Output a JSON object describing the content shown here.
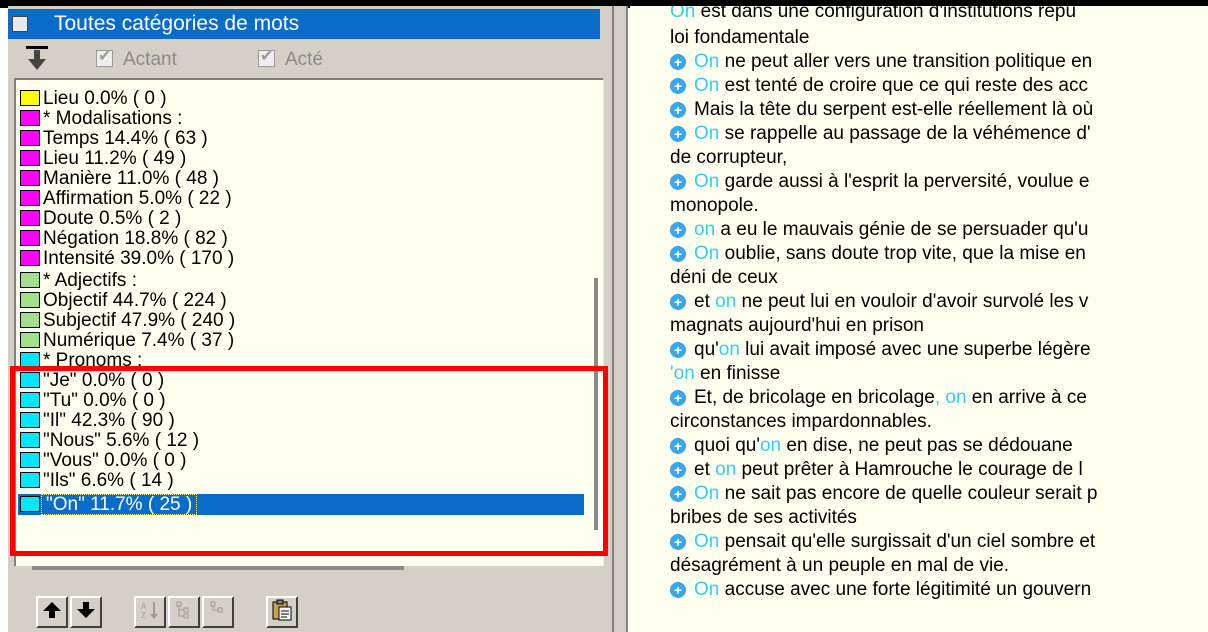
{
  "category_selector": {
    "label": "Toutes catégories de mots"
  },
  "filters": {
    "actant": {
      "label": "Actant",
      "checked": true,
      "enabled": false
    },
    "acte": {
      "label": "Acté",
      "checked": true,
      "enabled": false
    }
  },
  "colors": {
    "yellow": "#ffff00",
    "magenta": "#ff00ff",
    "green": "#a4e08c",
    "cyan": "#00e6ff",
    "selection": "#0a6cc9",
    "highlight": "#ff0000",
    "pronoun_text": "#34d0e8"
  },
  "categories": [
    {
      "label": "Lieu  0.0% ( 0 )",
      "color": "yellow"
    },
    {
      "label": "* Modalisations :",
      "color": "magenta"
    },
    {
      "label": "Temps  14.4% ( 63 )",
      "color": "magenta"
    },
    {
      "label": "Lieu  11.2% ( 49 )",
      "color": "magenta"
    },
    {
      "label": "Manière  11.0% ( 48 )",
      "color": "magenta"
    },
    {
      "label": "Affirmation  5.0% ( 22 )",
      "color": "magenta"
    },
    {
      "label": "Doute  0.5% ( 2 )",
      "color": "magenta"
    },
    {
      "label": "Négation  18.8% ( 82 )",
      "color": "magenta"
    },
    {
      "label": "Intensité  39.0% ( 170 )",
      "color": "magenta"
    },
    {
      "label": "* Adjectifs :",
      "color": "green"
    },
    {
      "label": "Objectif  44.7% ( 224 )",
      "color": "green"
    },
    {
      "label": "Subjectif  47.9% ( 240 )",
      "color": "green"
    },
    {
      "label": "Numérique  7.4% ( 37 )",
      "color": "green"
    },
    {
      "label": "* Pronoms :",
      "color": "cyan"
    },
    {
      "label": "\"Je\"  0.0% ( 0 )",
      "color": "cyan"
    },
    {
      "label": "\"Tu\"  0.0% ( 0 )",
      "color": "cyan"
    },
    {
      "label": "\"Il\"  42.3% ( 90 )",
      "color": "cyan"
    },
    {
      "label": "\"Nous\"  5.6% ( 12 )",
      "color": "cyan"
    },
    {
      "label": "\"Vous\"  0.0% ( 0 )",
      "color": "cyan"
    },
    {
      "label": "\"Ils\"  6.6% ( 14 )",
      "color": "cyan"
    },
    {
      "label": "\"On\"  11.7% ( 25 )",
      "color": "cyan",
      "selected": true
    }
  ],
  "toolbar": {
    "buttons": [
      {
        "icon": "move-up-icon",
        "enabled": true
      },
      {
        "icon": "move-down-icon",
        "enabled": true
      },
      {
        "icon": "sort-az-icon",
        "enabled": false
      },
      {
        "icon": "expand-tree-icon",
        "enabled": false
      },
      {
        "icon": "collapse-tree-icon",
        "enabled": false
      },
      {
        "icon": "clipboard-icon",
        "enabled": true
      }
    ]
  },
  "document": {
    "top_partial": {
      "before": "",
      "pronoun": "On",
      "after": " est dans une configuration d'institutions répu"
    },
    "lines": [
      {
        "bullet": false,
        "before": "loi fondamentale",
        "pronoun": "",
        "after": ""
      },
      {
        "bullet": true,
        "before": "",
        "pronoun": "On",
        "after": " ne peut aller vers une transition politique  en"
      },
      {
        "bullet": true,
        "before": "",
        "pronoun": "On",
        "after": " est tenté de croire que ce qui reste des acc"
      },
      {
        "bullet": true,
        "before": "Mais la tête du serpent est-elle réellement là où",
        "pronoun": "",
        "after": ""
      },
      {
        "bullet": true,
        "before": "",
        "pronoun": "On",
        "after": " se rappelle au passage de la véhémence d'"
      },
      {
        "bullet": false,
        "before": "de corrupteur,",
        "pronoun": "",
        "after": ""
      },
      {
        "bullet": true,
        "before": "",
        "pronoun": "On",
        "after": " garde aussi à l'esprit la perversité,  voulue e"
      },
      {
        "bullet": false,
        "before": "monopole.",
        "pronoun": "",
        "after": ""
      },
      {
        "bullet": true,
        "before": " ",
        "pronoun": "on",
        "after": " a eu le mauvais génie de se persuader qu'u"
      },
      {
        "bullet": true,
        "before": "",
        "pronoun": "On",
        "after": " oublie, sans doute trop vite,  que la mise en"
      },
      {
        "bullet": false,
        "before": "déni de ceux",
        "pronoun": "",
        "after": ""
      },
      {
        "bullet": true,
        "before": " et ",
        "pronoun": "on",
        "after": " ne peut lui en vouloir d'avoir survolé les v"
      },
      {
        "bullet": false,
        "before": "magnats aujourd'hui en prison",
        "pronoun": "",
        "after": ""
      },
      {
        "bullet": true,
        "before": " qu'",
        "pronoun": "on",
        "after": " lui avait imposé avec une superbe légère"
      },
      {
        "bullet": false,
        "before": "",
        "pronoun": "'on",
        "after": " en finisse"
      },
      {
        "bullet": true,
        "before": "Et, de bricolage en bricolage",
        "pronoun": ", on",
        "after": " en arrive à ce"
      },
      {
        "bullet": false,
        "before": "circonstances impardonnables.",
        "pronoun": "",
        "after": ""
      },
      {
        "bullet": true,
        "before": " quoi qu'",
        "pronoun": "on",
        "after": " en dise,  ne peut pas se dédouane"
      },
      {
        "bullet": true,
        "before": " et ",
        "pronoun": "on",
        "after": " peut prêter à Hamrouche le courage de l"
      },
      {
        "bullet": true,
        "before": "",
        "pronoun": "On",
        "after": " ne sait pas encore de quelle couleur serait p"
      },
      {
        "bullet": false,
        "before": "bribes de ses activités",
        "pronoun": "",
        "after": ""
      },
      {
        "bullet": true,
        "before": "",
        "pronoun": "On",
        "after": " pensait qu'elle surgissait d'un ciel sombre et"
      },
      {
        "bullet": false,
        "before": "désagrément à un peuple en mal de vie.",
        "pronoun": "",
        "after": ""
      },
      {
        "bullet": true,
        "before": "",
        "pronoun": "On",
        "after": " accuse avec une forte légitimité un gouvern"
      },
      {
        "bullet": false,
        "before": "",
        "pronoun": "",
        "after": ""
      }
    ]
  }
}
